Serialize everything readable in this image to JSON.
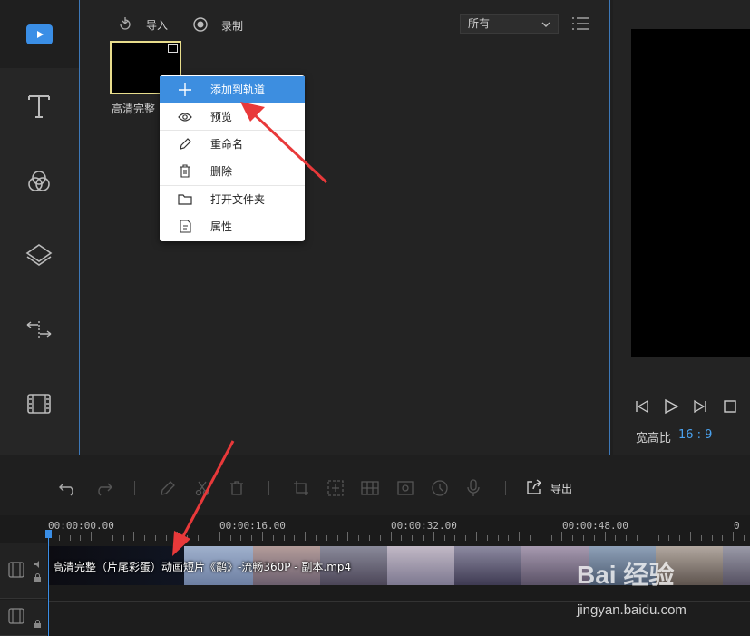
{
  "toolbar": {
    "import_label": "导入",
    "record_label": "录制"
  },
  "filter": {
    "selected": "所有"
  },
  "media_item": {
    "label": "高清完整"
  },
  "context_menu": {
    "items": [
      {
        "label": "添加到轨道",
        "icon": "plus-icon",
        "active": true
      },
      {
        "label": "预览",
        "icon": "eye-icon"
      },
      {
        "label": "重命名",
        "icon": "pencil-icon"
      },
      {
        "label": "删除",
        "icon": "trash-icon"
      },
      {
        "label": "打开文件夹",
        "icon": "folder-icon"
      },
      {
        "label": "属性",
        "icon": "properties-icon"
      }
    ]
  },
  "preview": {
    "aspect_label": "宽高比",
    "aspect_value": "16 : 9"
  },
  "edit_toolbar": {
    "export_label": "导出"
  },
  "timeline": {
    "ticks": [
      "00:00:00.00",
      "00:00:16.00",
      "00:00:32.00",
      "00:00:48.00"
    ],
    "clip_label": "高清完整（片尾彩蛋）动画短片《鹬》-流畅360P - 副本.mp4"
  },
  "watermark": {
    "brand": "Bai  经验",
    "url": "jingyan.baidu.com"
  },
  "colors": {
    "accent": "#3d8ee0",
    "selection_border": "#e8dd8c",
    "annotation_arrow": "#e8393a"
  }
}
